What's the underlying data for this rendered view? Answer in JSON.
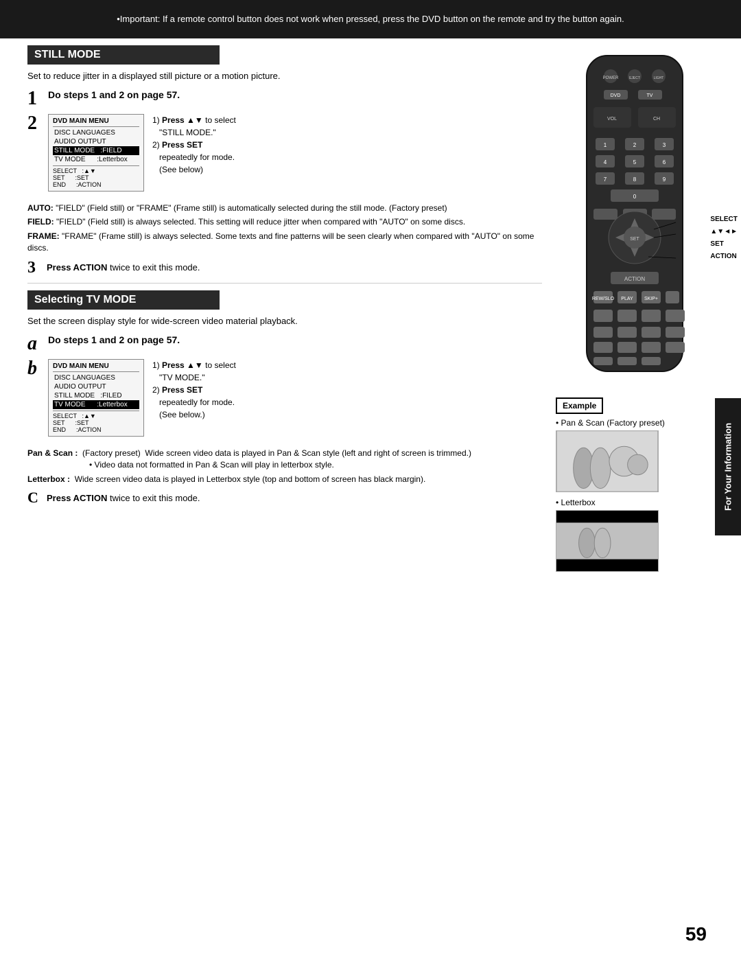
{
  "topBanner": {
    "text": "•Important:  If a remote control button does not work when pressed, press the DVD button on the remote and try the button again."
  },
  "stillMode": {
    "header": "STILL MODE",
    "intro": "Set to reduce jitter in a displayed still picture or a motion picture.",
    "step1": {
      "number": "1",
      "text": "Do steps 1 and 2 on page 57."
    },
    "step2": {
      "number": "2",
      "menuTitle": "DVD MAIN MENU",
      "menuItems": [
        "DISC LANGUAGES",
        "AUDIO OUTPUT",
        "STILL MODE    :FIELD",
        "TV MODE      :Letterbox"
      ],
      "menuFooter": [
        "SELECT    :▲▼",
        "SET       :SET",
        "END       :ACTION"
      ],
      "inst1": "Press ▲▼ to select \"STILL MODE.\"",
      "inst2": "Press SET repeatedly for mode. (See below)"
    },
    "descriptions": {
      "auto": {
        "label": "AUTO:",
        "text": "\"FIELD\" (Field still) or \"FRAME\" (Frame still) is automatically selected during the still mode. (Factory preset)"
      },
      "field": {
        "label": "FIELD:",
        "text": "\"FIELD\" (Field still) is always selected. This setting will reduce jitter when compared with \"AUTO\" on some discs."
      },
      "frame": {
        "label": "FRAME:",
        "text": "\"FRAME\" (Frame still) is always selected. Some texts and fine patterns will be seen clearly when compared with \"AUTO\" on some discs."
      }
    },
    "step3": {
      "number": "3",
      "text": "Press ACTION twice to exit this mode."
    }
  },
  "selectingTVMode": {
    "header": "Selecting TV MODE",
    "intro": "Set the screen display style for wide-screen video material playback.",
    "stepA": {
      "letter": "a",
      "text": "Do steps 1 and 2 on page 57."
    },
    "stepB": {
      "letter": "b",
      "menuTitle": "DVD MAIN MENU",
      "menuItems": [
        "DISC LANGUAGES",
        "AUDIO OUTPUT",
        "STILL MODE    :FILED",
        "TV MODE      :Letterbox"
      ],
      "menuFooter": [
        "SELECT    :▲▼",
        "SET       :SET",
        "END       :ACTION"
      ],
      "inst1": "Press ▲▼ to select \"TV MODE.\"",
      "inst2": "Press SET repeatedly for mode. (See below.)"
    },
    "panScan": {
      "label": "Pan & Scan :",
      "factoryNote": "(Factory preset)",
      "text": "Wide screen video data is played in Pan & Scan style (left and right of screen is trimmed.)",
      "bullet": "Video data not formatted in Pan & Scan will play in letterbox style."
    },
    "letterbox": {
      "label": "Letterbox :",
      "text": "Wide screen video data is played in Letterbox style (top and bottom of screen has black margin)."
    },
    "stepC": {
      "letter": "C",
      "text": "Press ACTION twice to exit this mode."
    },
    "example": {
      "label": "Example",
      "panScanLabel": "• Pan & Scan (Factory preset)",
      "letterboxLabel": "• Letterbox"
    }
  },
  "remote": {
    "selectLabel": "SELECT",
    "arrowLabel": "▲▼◄►",
    "setLabel": "SET",
    "actionLabel": "ACTION"
  },
  "sidebar": {
    "text": "For Your Information"
  },
  "pageNumber": "59",
  "pressToSelect": "Press to select"
}
